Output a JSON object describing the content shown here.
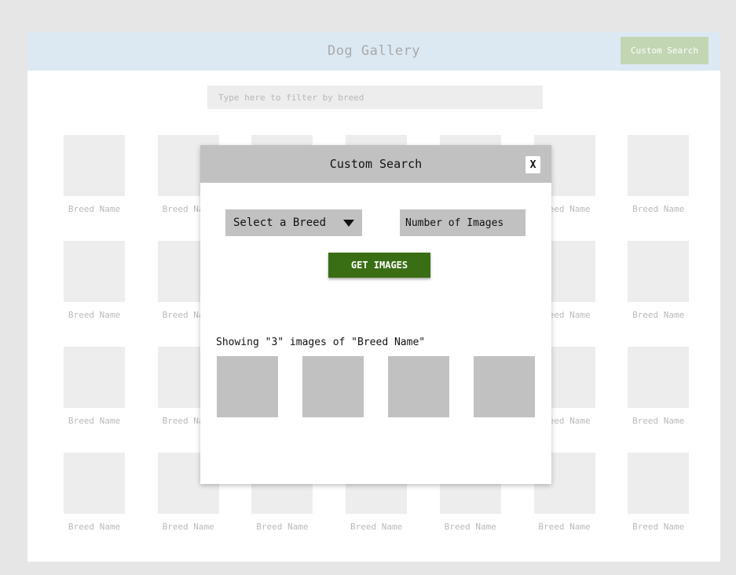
{
  "header": {
    "title": "Dog Gallery",
    "custom_search_label": "Custom Search"
  },
  "filter": {
    "placeholder": "Type here to filter by breed"
  },
  "gallery": {
    "tile_label": "Breed Name",
    "rows": 4,
    "columns": 7
  },
  "modal": {
    "title": "Custom Search",
    "close_label": "X",
    "breed_select_label": "Select a Breed",
    "number_placeholder": "Number of Images",
    "get_images_label": "GET IMAGES",
    "showing_text": "Showing \"3\" images of \"Breed Name\"",
    "result_count": 4
  },
  "colors": {
    "header_bg": "#dce9f3",
    "custom_search_bg": "#c2d6b3",
    "get_images_bg": "#3a6e14",
    "placeholder_grey": "#ededed",
    "modal_grey": "#c1c1c1"
  }
}
